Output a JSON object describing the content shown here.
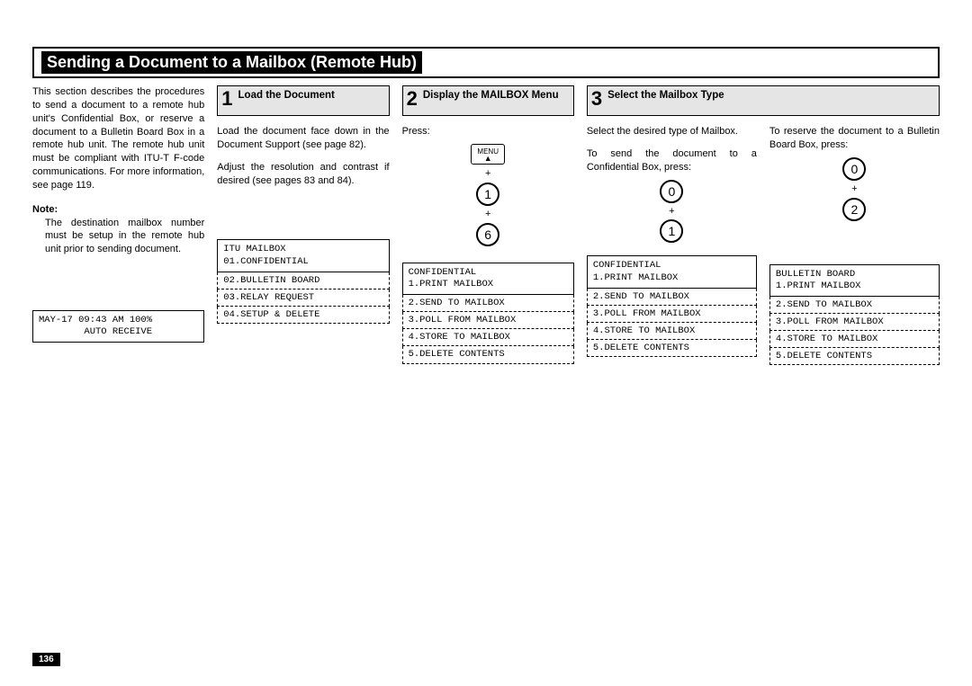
{
  "title": "Sending a Document to a Mailbox (Remote Hub)",
  "page_number": "136",
  "intro": "This section describes the procedures to send a document to a remote hub unit's Confidential Box, or reserve a document to a Bulletin Board Box in a remote hub unit. The remote hub unit must be compliant with ITU-T F-code communications. For more information, see page 119.",
  "note_label": "Note:",
  "note_body": "The destination mailbox number must be setup in the remote hub unit prior to sending document.",
  "intro_lcd": "MAY-17 09:43 AM 100%\n        AUTO RECEIVE",
  "step1": {
    "num": "1",
    "title": "Load the Document",
    "p1": "Load the document face down in the Document Support (see page 82).",
    "p2": "Adjust the resolution and contrast if desired (see pages 83 and 84).",
    "lcd_main": "ITU MAILBOX\n01.CONFIDENTIAL",
    "lcd_opts": [
      "02.BULLETIN BOARD",
      "03.RELAY REQUEST",
      "04.SETUP & DELETE"
    ]
  },
  "step2": {
    "num": "2",
    "title": "Display the MAILBOX Menu",
    "press": "Press:",
    "menu_label": "MENU",
    "key1": "1",
    "key2": "6",
    "plus": "+",
    "lcd_main": "CONFIDENTIAL\n1.PRINT MAILBOX",
    "lcd_opts": [
      "2.SEND TO MAILBOX",
      "3.POLL FROM MAILBOX",
      "4.STORE TO MAILBOX",
      "5.DELETE CONTENTS"
    ]
  },
  "step3": {
    "num": "3",
    "title": "Select the Mailbox Type",
    "lead": "Select the desired type of Mailbox.",
    "conf_text": "To send the document to a Confidential Box, press:",
    "conf_k1": "0",
    "conf_k2": "1",
    "bull_text": "To reserve the document to a Bulletin Board Box, press:",
    "bull_k1": "0",
    "bull_k2": "2",
    "plus": "+",
    "lcd_main": "BULLETIN BOARD\n1.PRINT MAILBOX",
    "lcd_opts": [
      "2.SEND TO MAILBOX",
      "3.POLL FROM MAILBOX",
      "4.STORE TO MAILBOX",
      "5.DELETE CONTENTS"
    ]
  }
}
